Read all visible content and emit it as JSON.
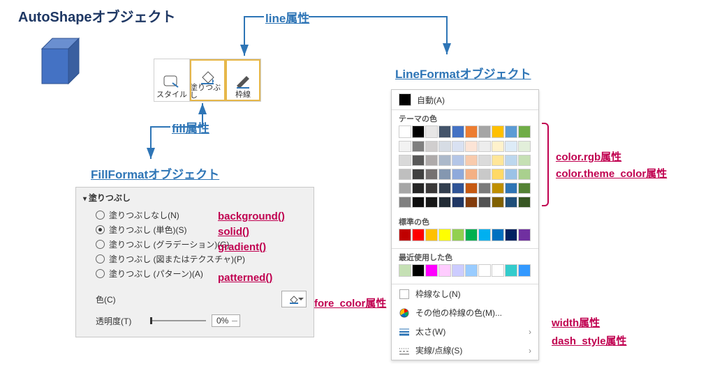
{
  "title": "AutoShapeオブジェクト",
  "attrs": {
    "line": "line属性",
    "fill": "fill属性",
    "width": "width属性",
    "dash_style": "dash_style属性",
    "color_rgb": "color.rgb属性",
    "color_theme": "color.theme_color属性",
    "fore_color": "fore_color属性"
  },
  "objects": {
    "fillformat": "FillFormatオブジェクト",
    "lineformat": "LineFormatオブジェクト"
  },
  "ribbon": {
    "style": "スタイル",
    "fill": "塗りつぶし",
    "border": "枠線"
  },
  "fillpanel": {
    "section": "塗りつぶし",
    "none": "塗りつぶしなし(N)",
    "solid": "塗りつぶし (単色)(S)",
    "gradient": "塗りつぶし (グラデーション)(G)",
    "picture": "塗りつぶし (図またはテクスチャ)(P)",
    "pattern": "塗りつぶし (パターン)(A)",
    "color": "色(C)",
    "transparency": "透明度(T)",
    "transparency_val": "0%"
  },
  "methods": {
    "background": "background()",
    "solid": "solid()",
    "gradient": "gradient()",
    "patterned": "patterned()"
  },
  "linepanel": {
    "auto": "自動(A)",
    "theme": "テーマの色",
    "standard": "標準の色",
    "recent": "最近使用した色",
    "noline": "枠線なし(N)",
    "more": "その他の枠線の色(M)...",
    "weight": "太さ(W)",
    "dash": "実線/点線(S)"
  },
  "colors": {
    "theme_row": [
      "#ffffff",
      "#000000",
      "#e7e6e6",
      "#44546a",
      "#4472c4",
      "#ed7d31",
      "#a5a5a5",
      "#ffc000",
      "#5b9bd5",
      "#70ad47"
    ],
    "theme_shades": [
      [
        "#f2f2f2",
        "#7f7f7f",
        "#d0cece",
        "#d6dce4",
        "#d9e1f2",
        "#fce4d6",
        "#ededed",
        "#fff2cc",
        "#ddebf7",
        "#e2efda"
      ],
      [
        "#d9d9d9",
        "#595959",
        "#aeaaaa",
        "#acb9ca",
        "#b4c6e7",
        "#f8cbad",
        "#dbdbdb",
        "#ffe699",
        "#bdd7ee",
        "#c6e0b4"
      ],
      [
        "#bfbfbf",
        "#404040",
        "#757171",
        "#8497b0",
        "#8ea9db",
        "#f4b084",
        "#c9c9c9",
        "#ffd966",
        "#9bc2e6",
        "#a9d08e"
      ],
      [
        "#a6a6a6",
        "#262626",
        "#3a3838",
        "#333f4f",
        "#305496",
        "#c65911",
        "#7b7b7b",
        "#bf8f00",
        "#2f75b5",
        "#548235"
      ],
      [
        "#808080",
        "#0d0d0d",
        "#161616",
        "#222b35",
        "#203764",
        "#833c0c",
        "#525252",
        "#806000",
        "#1f4e78",
        "#375623"
      ]
    ],
    "standard_row": [
      "#c00000",
      "#ff0000",
      "#ffc000",
      "#ffff00",
      "#92d050",
      "#00b050",
      "#00b0f0",
      "#0070c0",
      "#002060",
      "#7030a0"
    ],
    "recent_row": [
      "#c5e0b4",
      "#000000",
      "#ff00ff",
      "#ffccff",
      "#ccccff",
      "#99ccff",
      "#ffffff",
      "#ffffff",
      "#33cccc",
      "#3399ff"
    ]
  }
}
